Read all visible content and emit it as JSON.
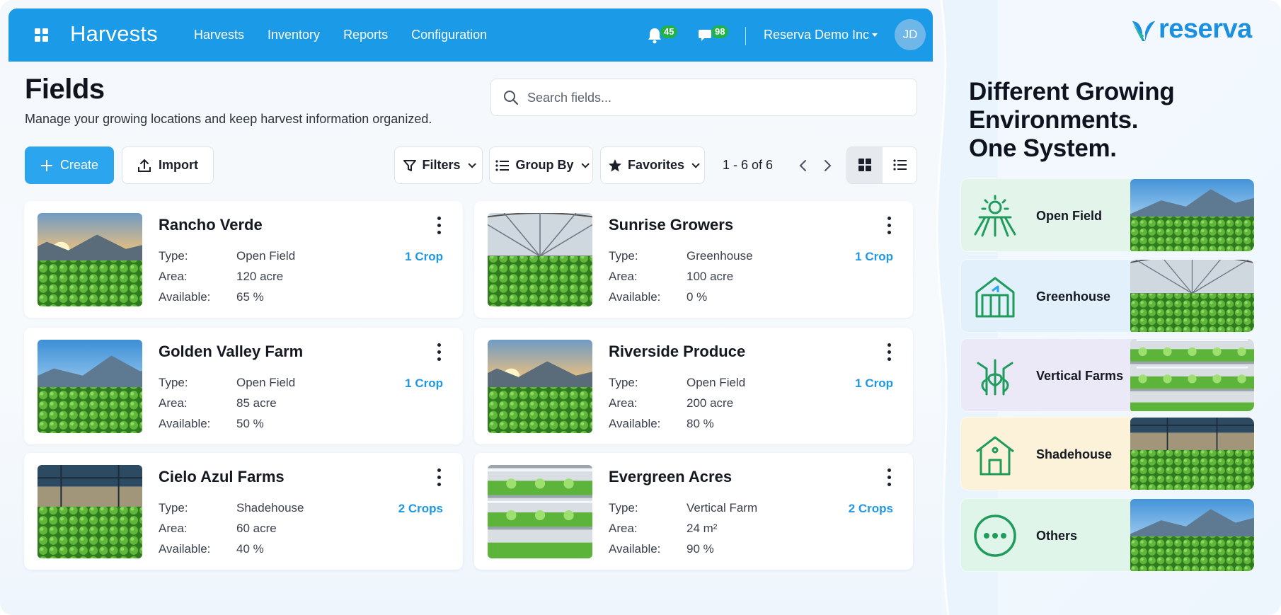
{
  "app": {
    "title": "Harvests",
    "nav": [
      "Harvests",
      "Inventory",
      "Reports",
      "Configuration"
    ],
    "notifications_count": "45",
    "messages_count": "98",
    "company": "Reserva Demo Inc",
    "user_initials": "JD"
  },
  "page": {
    "title": "Fields",
    "subtitle": "Manage your growing locations and keep harvest information organized.",
    "search_placeholder": "Search fields..."
  },
  "toolbar": {
    "create_label": "Create",
    "import_label": "Import",
    "filters_label": "Filters",
    "groupby_label": "Group By",
    "favorites_label": "Favorites",
    "pager": "1 - 6 of 6"
  },
  "field_labels": {
    "type": "Type:",
    "area": "Area:",
    "available": "Available:"
  },
  "fields": [
    {
      "name": "Rancho Verde",
      "type": "Open Field",
      "area": "120 acre",
      "available": "65 %",
      "crops": "1 Crop",
      "image": "open-field-sunrise"
    },
    {
      "name": "Sunrise Growers",
      "type": "Greenhouse",
      "area": "100 acre",
      "available": "0 %",
      "crops": "1 Crop",
      "image": "greenhouse"
    },
    {
      "name": "Golden Valley Farm",
      "type": "Open Field",
      "area": "85 acre",
      "available": "50 %",
      "crops": "1 Crop",
      "image": "open-field-mountains"
    },
    {
      "name": "Riverside Produce",
      "type": "Open Field",
      "area": "200 acre",
      "available": "80 %",
      "crops": "1 Crop",
      "image": "open-field-sunrise"
    },
    {
      "name": "Cielo Azul Farms",
      "type": "Shadehouse",
      "area": "60 acre",
      "available": "40 %",
      "crops": "2 Crops",
      "image": "shadehouse"
    },
    {
      "name": "Evergreen Acres",
      "type": "Vertical Farm",
      "area": "24 m²",
      "available": "90 %",
      "crops": "2 Crops",
      "image": "vertical-farm"
    }
  ],
  "promo": {
    "brand": "reserva",
    "headline": [
      "Different Growing",
      "Environments.",
      "One System."
    ],
    "environments": [
      {
        "label": "Open Field",
        "icon": "sun-field-icon",
        "bg": "#e3f5ea",
        "image": "open-field-mountains"
      },
      {
        "label": "Greenhouse",
        "icon": "greenhouse-icon",
        "bg": "#e1f0fa",
        "image": "greenhouse"
      },
      {
        "label": "Vertical Farms",
        "icon": "vertical-farm-icon",
        "bg": "#ebe8f8",
        "image": "vertical-farm"
      },
      {
        "label": "Shadehouse",
        "icon": "shadehouse-icon",
        "bg": "#fbf2d9",
        "image": "shadehouse"
      },
      {
        "label": "Others",
        "icon": "more-icon",
        "bg": "#e0f5ea",
        "image": "open-field-mountains"
      }
    ]
  },
  "colors": {
    "primary": "#1b9ae8",
    "accent": "#1e97e4",
    "badge": "#21b24a",
    "icon_green": "#1f9c5c"
  }
}
